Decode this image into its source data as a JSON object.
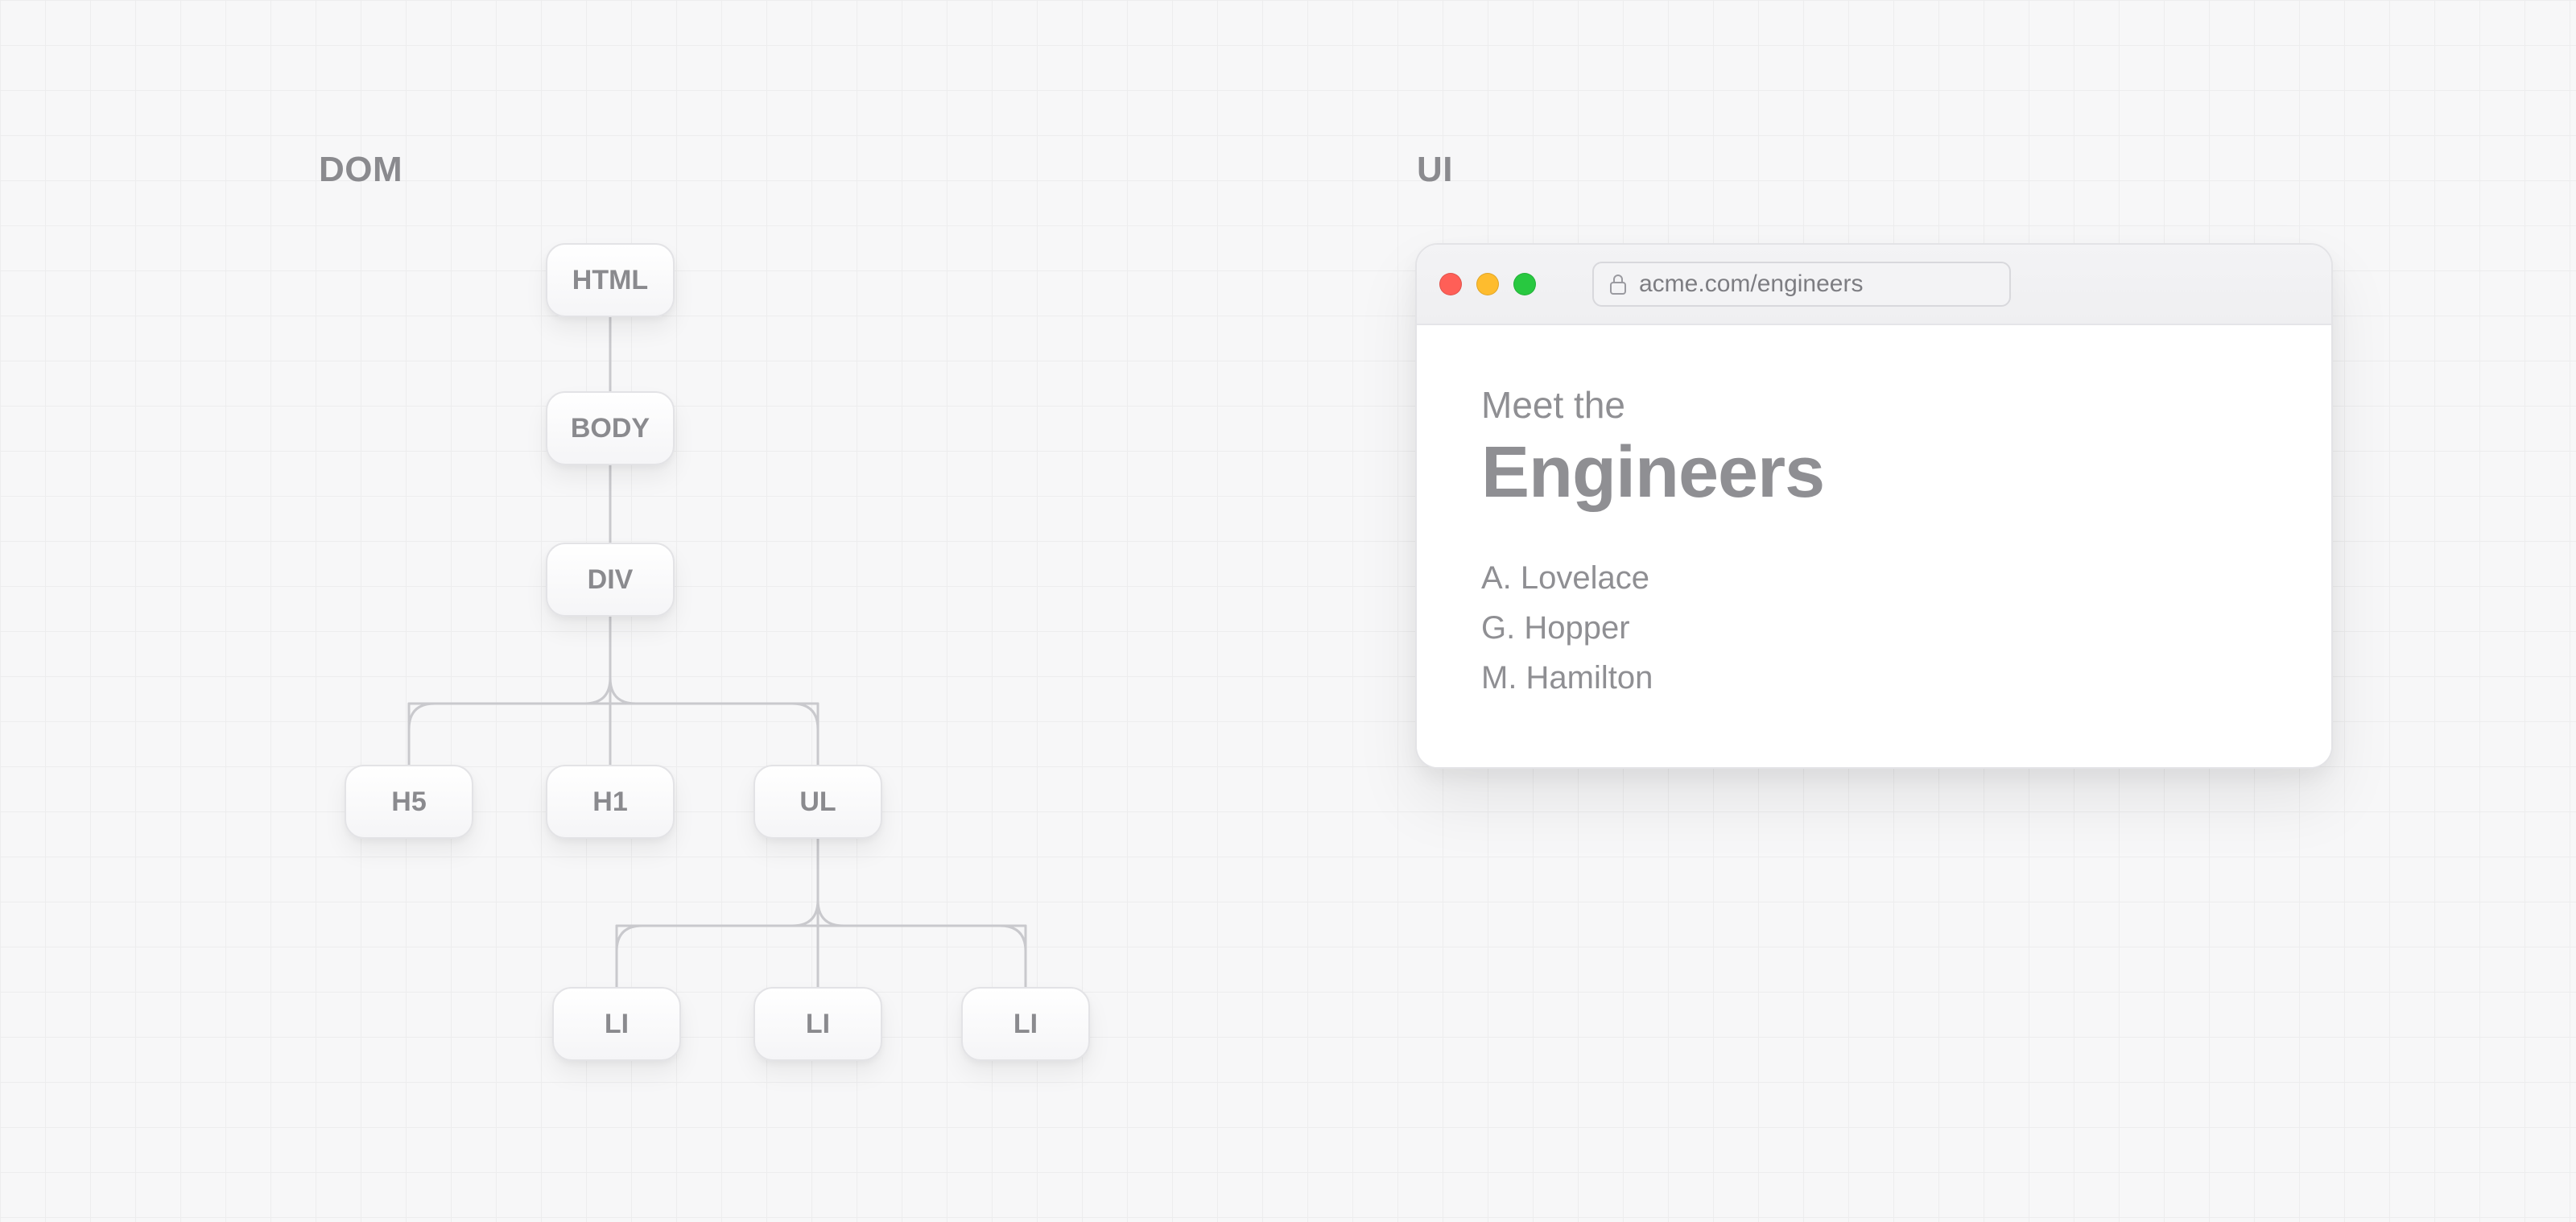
{
  "sections": {
    "dom_label": "DOM",
    "ui_label": "UI"
  },
  "tree": {
    "root": "HTML",
    "body": "BODY",
    "div": "DIV",
    "children": [
      "H5",
      "H1",
      "UL"
    ],
    "list_items": [
      "LI",
      "LI",
      "LI"
    ]
  },
  "browser": {
    "url": "acme.com/engineers",
    "page": {
      "kicker": "Meet the",
      "title": "Engineers",
      "engineers": [
        "A. Lovelace",
        "G. Hopper",
        "M. Hamilton"
      ]
    }
  }
}
